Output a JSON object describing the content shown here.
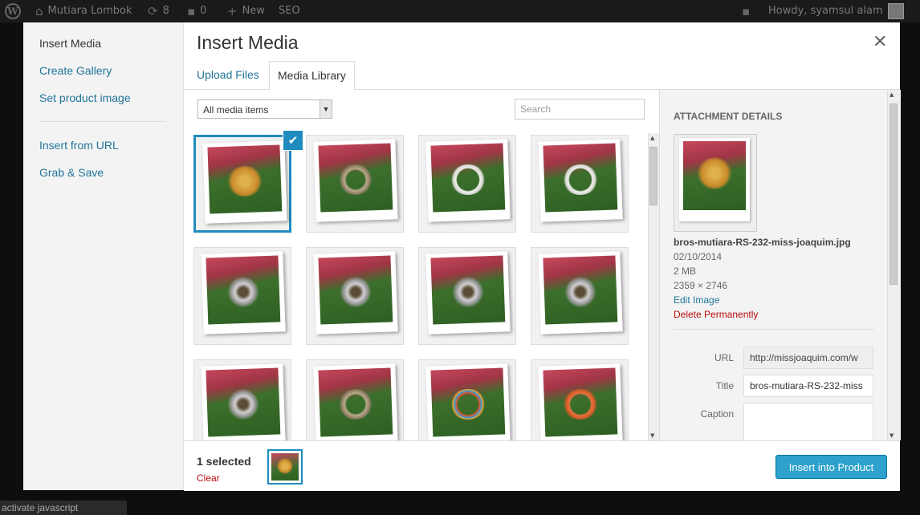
{
  "admin_bar": {
    "site_name": "Mutiara Lombok",
    "updates_count": "8",
    "comments_count": "0",
    "new_label": "New",
    "seo_label": "SEO",
    "howdy": "Howdy, syamsul alam"
  },
  "modal": {
    "title": "Insert Media",
    "close_icon": "close-icon",
    "menu": {
      "items": [
        "Insert Media",
        "Create Gallery",
        "Set product image"
      ],
      "extra_items": [
        "Insert from URL",
        "Grab & Save"
      ]
    },
    "tabs": [
      "Upload Files",
      "Media Library"
    ],
    "active_tab": "Media Library",
    "filter": {
      "selected": "All media items"
    },
    "search": {
      "placeholder": "Search"
    }
  },
  "grid": {
    "items": [
      {
        "kind": "gold-brooch",
        "selected": true
      },
      {
        "kind": "wire"
      },
      {
        "kind": "pearl"
      },
      {
        "kind": "pearl"
      },
      {
        "kind": "silver"
      },
      {
        "kind": "silver"
      },
      {
        "kind": "silver"
      },
      {
        "kind": "silver"
      },
      {
        "kind": "silver"
      },
      {
        "kind": "wire"
      },
      {
        "kind": "beads"
      },
      {
        "kind": "coral"
      }
    ]
  },
  "attachment": {
    "heading": "ATTACHMENT DETAILS",
    "filename": "bros-mutiara-RS-232-miss-joaquim.jpg",
    "date": "02/10/2014",
    "size": "2 MB",
    "dimensions": "2359 × 2746",
    "edit_link": "Edit Image",
    "delete_link": "Delete Permanently",
    "fields": {
      "url_label": "URL",
      "url_value": "http://missjoaquim.com/w",
      "title_label": "Title",
      "title_value": "bros-mutiara-RS-232-miss",
      "caption_label": "Caption",
      "caption_value": ""
    }
  },
  "footer": {
    "selected_count": "1 selected",
    "clear_label": "Clear",
    "insert_button": "Insert into Product"
  },
  "status_bar": {
    "text": "activate javascript"
  },
  "colors": {
    "accent": "#1e8cbe",
    "button": "#2ea2cc",
    "link": "#21759b",
    "danger": "#bc0b0b"
  }
}
